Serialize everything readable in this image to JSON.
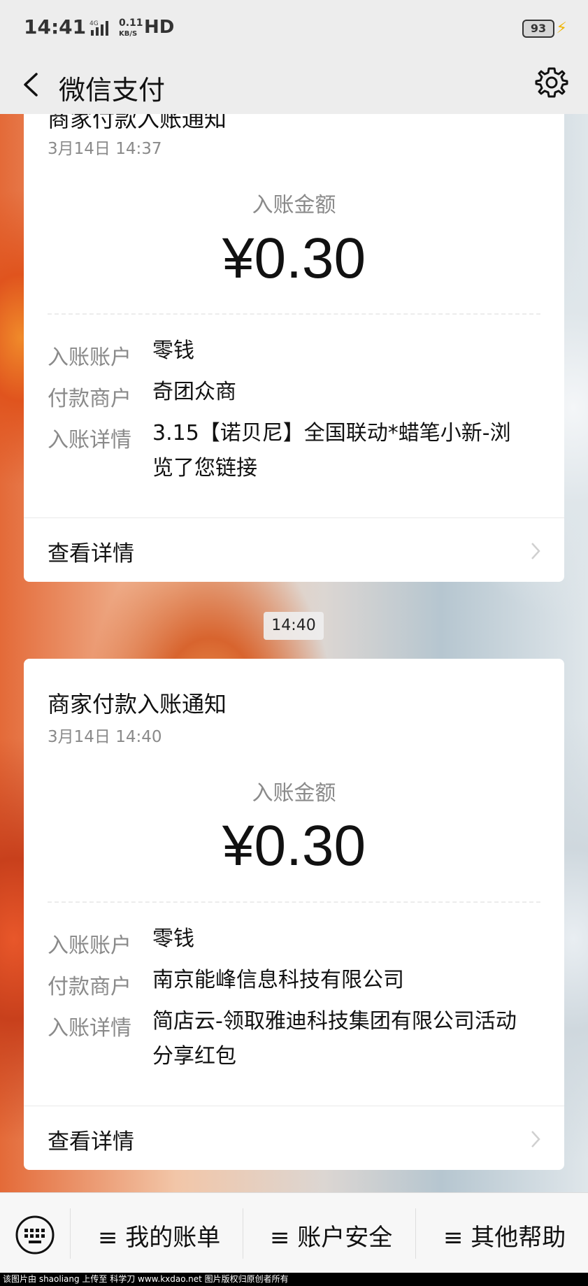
{
  "status_bar": {
    "time": "14:41",
    "network": "4G",
    "speed_value": "0.11",
    "speed_unit": "KB/S",
    "hd": "HD",
    "battery": "93"
  },
  "header": {
    "title": "微信支付"
  },
  "cards": [
    {
      "title": "商家付款入账通知",
      "date": "3月14日  14:37",
      "amount_label": "入账金额",
      "amount": "¥0.30",
      "rows": [
        {
          "key": "入账账户",
          "value": "零钱"
        },
        {
          "key": "付款商户",
          "value": "奇团众商"
        },
        {
          "key": "入账详情",
          "value_line1": "3.15【诺贝尼】全国联动*蜡笔小新-浏",
          "value_line2": "览了您链接"
        }
      ],
      "view_details": "查看详情"
    },
    {
      "title": "商家付款入账通知",
      "date": "3月14日  14:40",
      "amount_label": "入账金额",
      "amount": "¥0.30",
      "rows": [
        {
          "key": "入账账户",
          "value": "零钱"
        },
        {
          "key": "付款商户",
          "value": "南京能峰信息科技有限公司"
        },
        {
          "key": "入账详情",
          "value_line1": "简店云-领取雅迪科技集团有限公司活动",
          "value_line2": "分享红包"
        }
      ],
      "view_details": "查看详情"
    }
  ],
  "time_separator": "14:40",
  "bottom_menu": {
    "items": [
      "≡ 我的账单",
      "≡ 账户安全",
      "≡ 其他帮助"
    ]
  },
  "footer": "该图片由 shaoliang 上传至 科学刀 www.kxdao.net 图片版权归原创者所有"
}
